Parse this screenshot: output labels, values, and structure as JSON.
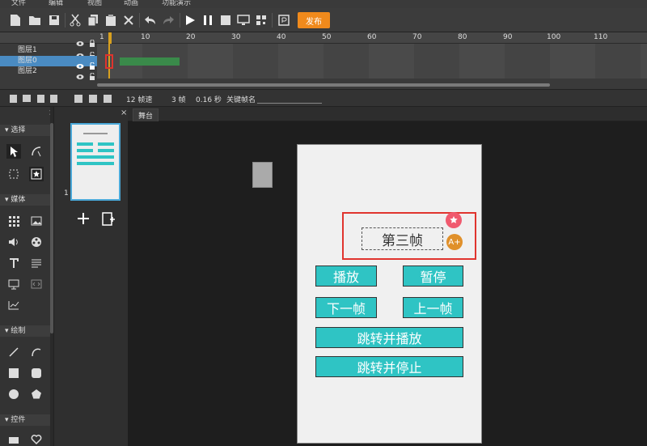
{
  "menu": [
    "文件",
    "编辑",
    "视图",
    "动画",
    "功能演示"
  ],
  "toolbar": {
    "publish": "发布"
  },
  "timeline": {
    "ruler": [
      "1",
      "10",
      "20",
      "30",
      "40",
      "50",
      "60",
      "70",
      "80",
      "90",
      "100",
      "110"
    ],
    "layers": [
      "图层1",
      "图层0",
      "图层2"
    ]
  },
  "info": {
    "fps": "12 帧速",
    "frames": "3 帧",
    "time": "0.16 秒",
    "keyframe_label": "关键帧名"
  },
  "tools": {
    "sections": [
      "选择",
      "媒体",
      "绘制",
      "控件"
    ]
  },
  "pages": {
    "page_number": "1"
  },
  "stage": {
    "tab": "舞台",
    "text": "第三帧",
    "buttons": {
      "play": "播放",
      "pause": "暂停",
      "next": "下一帧",
      "prev": "上一帧",
      "goto_play": "跳转并播放",
      "goto_stop": "跳转并停止"
    },
    "badge_text": "A+"
  },
  "colors": {
    "accent": "#f08a1c",
    "button": "#2fc4c4",
    "selection": "#e0342e",
    "layer_selected": "#4a8bc2"
  }
}
